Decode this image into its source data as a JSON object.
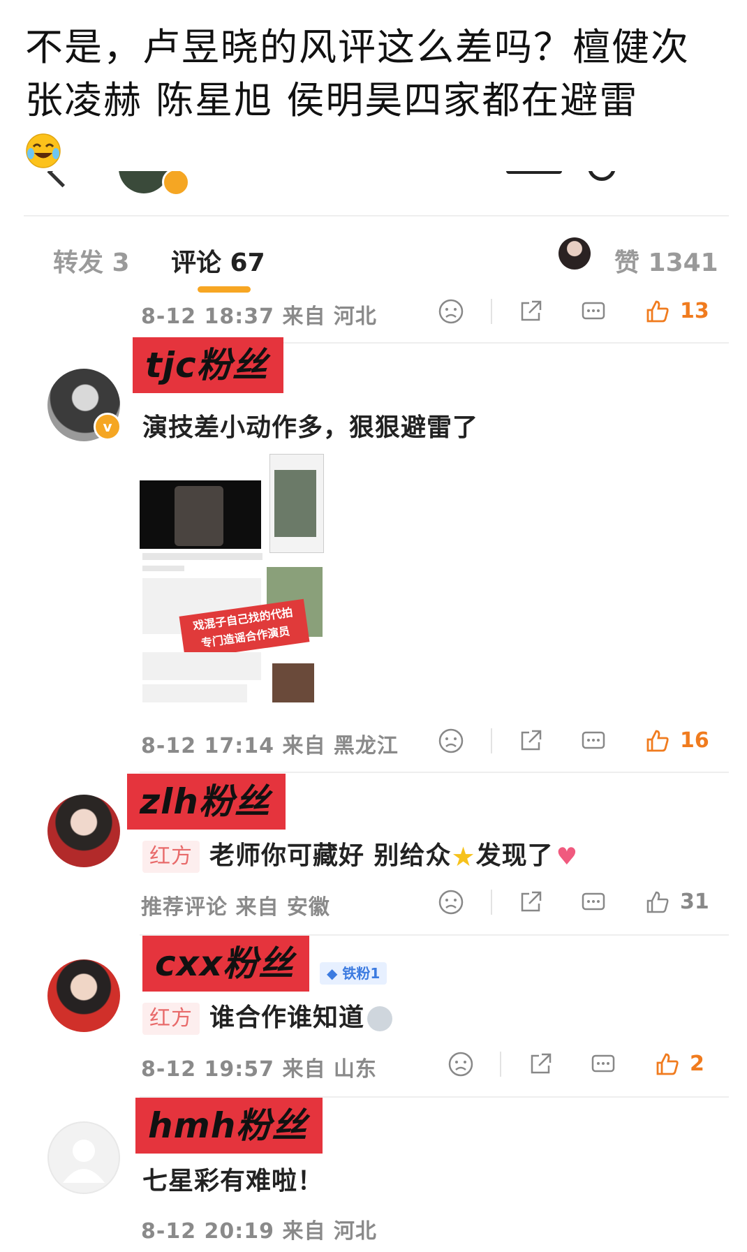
{
  "post": {
    "title_line1": "不是，卢昱晓的风评这么差吗？檀健次",
    "title_line2": "张凌赫  陈星旭  侯明昊四家都在避雷",
    "emoji": "laughing-crying"
  },
  "tabs": {
    "repost": "转发 3",
    "comment": "评论 67",
    "likes": "赞 1341"
  },
  "rows": {
    "first": {
      "meta": "8-12 18:37  来自 河北",
      "likes": "13"
    }
  },
  "comments": [
    {
      "name": "tjc粉丝",
      "text": "演技差小动作多，狠狠避雷了",
      "image_overlay": [
        "戏混子自己找的代拍",
        "专门造谣合作演员"
      ],
      "meta": "8-12 17:14  来自 黑龙江",
      "likes": "16"
    },
    {
      "name": "zlh粉丝",
      "tag": "红方",
      "text": "老师你可藏好 别给众",
      "text_after": "发现了",
      "meta": "推荐评论  来自 安徽",
      "likes": "31"
    },
    {
      "name": "cxx粉丝",
      "badge": "铁粉1",
      "tag": "红方",
      "text": "谁合作谁知道",
      "meta": "8-12 19:57  来自 山东",
      "likes": "2"
    },
    {
      "name": "hmh粉丝",
      "text": "七星彩有难啦！",
      "meta": "8-12 20:19  来自 河北"
    }
  ],
  "colors": {
    "accent_orange": "#f7a623",
    "name_label_red": "#e5343d",
    "like_active": "#f07b1e",
    "meta_gray": "#8a8a8a"
  }
}
